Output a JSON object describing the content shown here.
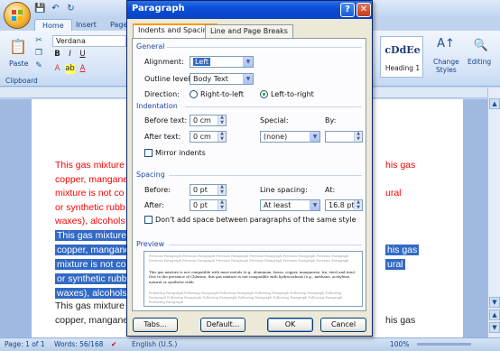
{
  "word": {
    "tabs": [
      "Home",
      "Insert",
      "Page"
    ],
    "font": "Verdana",
    "paste_label": "Paste",
    "clipboard_label": "Clipboard",
    "style_sample": "cDdEe",
    "style_name": "Heading 1",
    "change_styles": "Change\nStyles",
    "editing": "Editing",
    "doc_lines": [
      {
        "left": "This gas mixture",
        "right": "his gas",
        "kind": "red"
      },
      {
        "left": "copper, mangane",
        "right": "",
        "kind": "red"
      },
      {
        "left": "mixture is not co",
        "right": "ural",
        "kind": "red"
      },
      {
        "left": "or synthetic rubb",
        "right": "",
        "kind": "red"
      },
      {
        "left": "waxes), alcohols",
        "right": "",
        "kind": "red"
      },
      {
        "left": "This gas mixture",
        "right": "",
        "kind": "sel"
      },
      {
        "left": "copper, mangane",
        "right": "his gas",
        "kind": "sel"
      },
      {
        "left": "mixture is not co",
        "right": "ural",
        "kind": "sel"
      },
      {
        "left": "or synthetic rubb",
        "right": "",
        "kind": "sel"
      },
      {
        "left": "waxes), alcohols",
        "right": "",
        "kind": "sel"
      },
      {
        "left": "This gas mixture",
        "right": "",
        "kind": "dark"
      },
      {
        "left": "copper, mangane",
        "right": "his gas",
        "kind": "dark"
      }
    ],
    "status": {
      "page": "Page: 1 of 1",
      "words": "Words: 56/168",
      "language": "English (U.S.)",
      "zoom": "100%"
    }
  },
  "dialog": {
    "title": "Paragraph",
    "tabs": [
      "Indents and Spacing",
      "Line and Page Breaks"
    ],
    "general": {
      "heading": "General",
      "alignment_label": "Alignment:",
      "alignment_value": "Left",
      "outline_label": "Outline level:",
      "outline_value": "Body Text",
      "direction_label": "Direction:",
      "rtl_label": "Right-to-left",
      "ltr_label": "Left-to-right"
    },
    "indentation": {
      "heading": "Indentation",
      "before_label": "Before text:",
      "before_value": "0 cm",
      "after_label": "After text:",
      "after_value": "0 cm",
      "special_label": "Special:",
      "special_value": "(none)",
      "by_label": "By:",
      "by_value": "",
      "mirror_label": "Mirror indents"
    },
    "spacing": {
      "heading": "Spacing",
      "before_label": "Before:",
      "before_value": "0 pt",
      "after_label": "After:",
      "after_value": "0 pt",
      "line_label": "Line spacing:",
      "line_value": "At least",
      "at_label": "At:",
      "at_value": "16.8 pt",
      "dont_add_label": "Don't add space between paragraphs of the same style"
    },
    "preview": {
      "heading": "Preview",
      "prev_text": "Previous Paragraph Previous Paragraph Previous Paragraph Previous Paragraph Previous Paragraph Previous Paragraph Previous Paragraph Previous Paragraph Previous Paragraph Previous Paragraph Previous Paragraph Previous Paragraph",
      "sample_text": "This gas mixture is not compatible with most metals (e.g., aluminum, brass, copper, manganese, tin, steel and iron). Due to the presence of Chlorine, this gas mixture is not compatible with hydrocarbons (e.g., methane, acetylene, natural or synthetic rubb",
      "next_text": "Following Paragraph Following Paragraph Following Paragraph Following Paragraph Following Paragraph Following Paragraph Following Paragraph Following Paragraph Following Paragraph Following Paragraph Following Paragraph Following Paragraph"
    },
    "buttons": {
      "tabs": "Tabs...",
      "default": "Default...",
      "ok": "OK",
      "cancel": "Cancel"
    }
  },
  "colors": {
    "dialog_title": "#0b4ed7",
    "red_text": "#ff0000",
    "selection": "#316ac5",
    "section_heading": "#1f4aa8"
  }
}
